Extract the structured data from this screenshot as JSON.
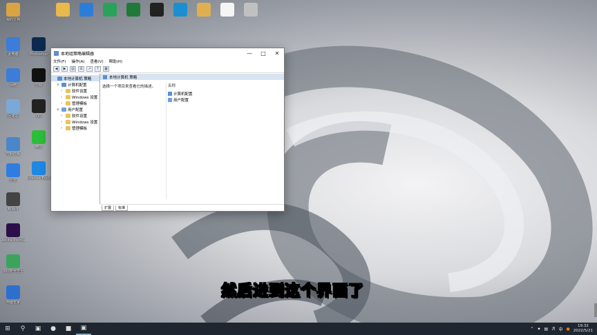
{
  "window": {
    "title": "本地组策略编辑器",
    "menus": [
      "文件(F)",
      "操作(A)",
      "查看(V)",
      "帮助(H)"
    ],
    "tree": [
      {
        "label": "本地计算机 策略",
        "level": 0,
        "type": "pc",
        "selected": true
      },
      {
        "label": "计算机配置",
        "level": 1,
        "type": "pc",
        "expanded": true
      },
      {
        "label": "软件设置",
        "level": 2,
        "type": "folder"
      },
      {
        "label": "Windows 设置",
        "level": 2,
        "type": "folder"
      },
      {
        "label": "管理模板",
        "level": 2,
        "type": "folder"
      },
      {
        "label": "用户配置",
        "level": 1,
        "type": "usr",
        "expanded": true
      },
      {
        "label": "软件设置",
        "level": 2,
        "type": "folder"
      },
      {
        "label": "Windows 设置",
        "level": 2,
        "type": "folder"
      },
      {
        "label": "管理模板",
        "level": 2,
        "type": "folder"
      }
    ],
    "right_header": "本地计算机 策略",
    "right_description": "选择一个项目来查看它的描述。",
    "column_header": "名称",
    "items": [
      "计算机配置",
      "用户配置"
    ],
    "tabs": [
      "扩展",
      "标准"
    ]
  },
  "subtitle": "然后进到这个界面了",
  "desktop_icons": [
    {
      "label": "我的文档",
      "color": "#d9a441"
    },
    {
      "label": "此电脑",
      "color": "#3b7dd8"
    },
    {
      "label": "网络",
      "color": "#3b7dd8"
    },
    {
      "label": "回收站",
      "color": "#7aa9d8"
    },
    {
      "label": "控制面板",
      "color": "#4a86c8"
    },
    {
      "label": "迅雷",
      "color": "#2f7de1"
    },
    {
      "label": "Bilibili",
      "color": "#444"
    },
    {
      "label": "Adobe Premiere",
      "color": "#2b0f4a"
    },
    {
      "label": "360安全卫士",
      "color": "#3aa55a"
    },
    {
      "label": "电脑管家",
      "color": "#2d6fcf"
    },
    {
      "label": "Photoshop",
      "color": "#0c2a4d"
    },
    {
      "label": "剪映",
      "color": "#111"
    },
    {
      "label": "QQ",
      "color": "#222"
    },
    {
      "label": "微信",
      "color": "#2cbd3a"
    },
    {
      "label": "Internet Explorer",
      "color": "#1e88e5"
    }
  ],
  "taskbar": {
    "time": "19:32",
    "date": "2022/5/21",
    "lang": "中"
  }
}
